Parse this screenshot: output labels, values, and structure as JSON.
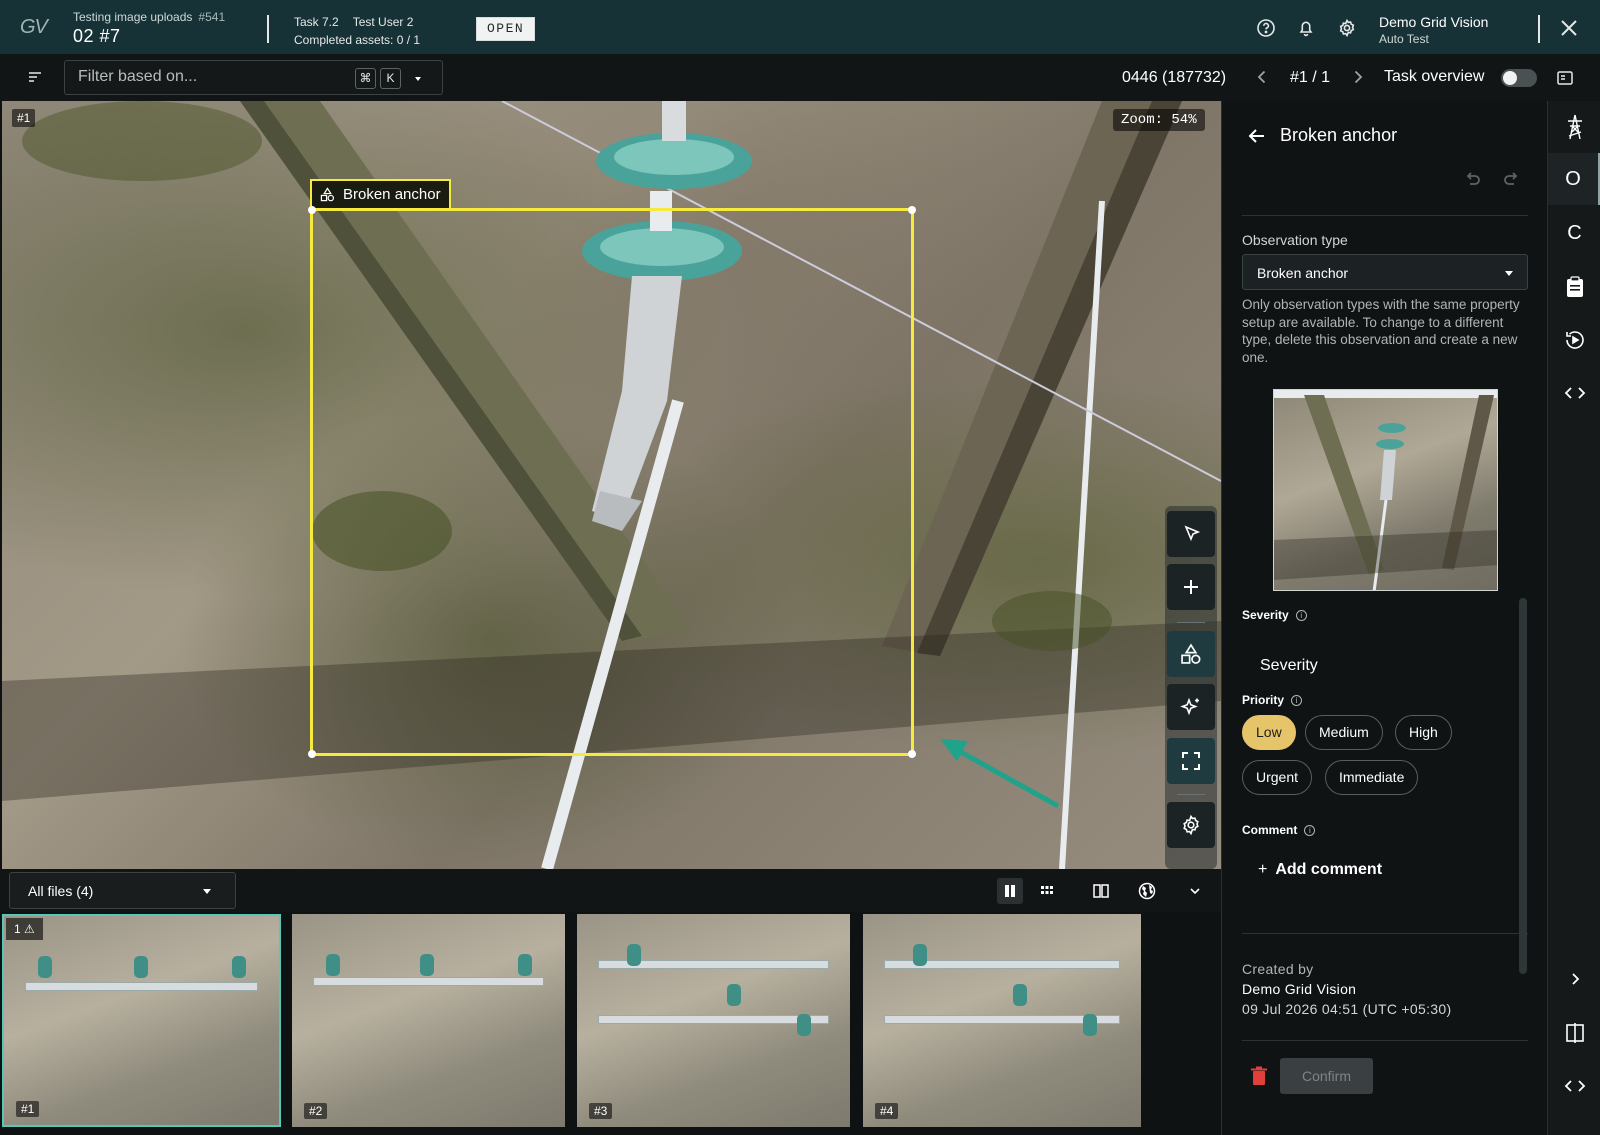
{
  "header": {
    "logo": "GV",
    "project_title": "Testing image uploads",
    "project_number": "#541",
    "item_code": "02 #7",
    "task": "Task 7.2",
    "assignee": "Test User 2",
    "completed": "Completed assets: 0 / 1",
    "status": "OPEN",
    "user_name": "Demo Grid Vision",
    "user_role": "Auto Test"
  },
  "filterbar": {
    "placeholder": "Filter based on...",
    "kbd_mod": "⌘",
    "kbd_key": "K",
    "asset_counter": "0446 (187732)",
    "pager": "#1 / 1",
    "task_overview": "Task overview"
  },
  "viewer": {
    "image_tag": "#1",
    "zoom": "Zoom: 54%",
    "annotation_label": "Broken anchor"
  },
  "filmstrip": {
    "files_select": "All files (4)",
    "selected_badge": "1",
    "thumbs": [
      {
        "label": "#1",
        "selected": true
      },
      {
        "label": "#2",
        "selected": false
      },
      {
        "label": "#3",
        "selected": false
      },
      {
        "label": "#4",
        "selected": false
      }
    ]
  },
  "panel": {
    "title": "Broken anchor",
    "observation_type_label": "Observation type",
    "observation_type_value": "Broken anchor",
    "helper": "Only observation types with the same property setup are available. To change to a different type, delete this observation and create a new one.",
    "severity_label": "Severity",
    "severity_value": "Severity",
    "priority_label": "Priority",
    "priorities": [
      "Low",
      "Medium",
      "High",
      "Urgent",
      "Immediate"
    ],
    "priority_selected": "Low",
    "comment_label": "Comment",
    "add_comment": "Add comment",
    "created_by_label": "Created by",
    "created_by": "Demo Grid Vision",
    "created_at": "09 Jul 2026 04:51 (UTC +05:30)",
    "confirm": "Confirm"
  },
  "rail": {
    "items": [
      "O",
      "C"
    ]
  },
  "colors": {
    "topbar": "#163236",
    "bbox": "#f6ea3c",
    "priority_selected": "#e6c46a",
    "accent": "#58c7ba",
    "danger": "#e0403a"
  }
}
